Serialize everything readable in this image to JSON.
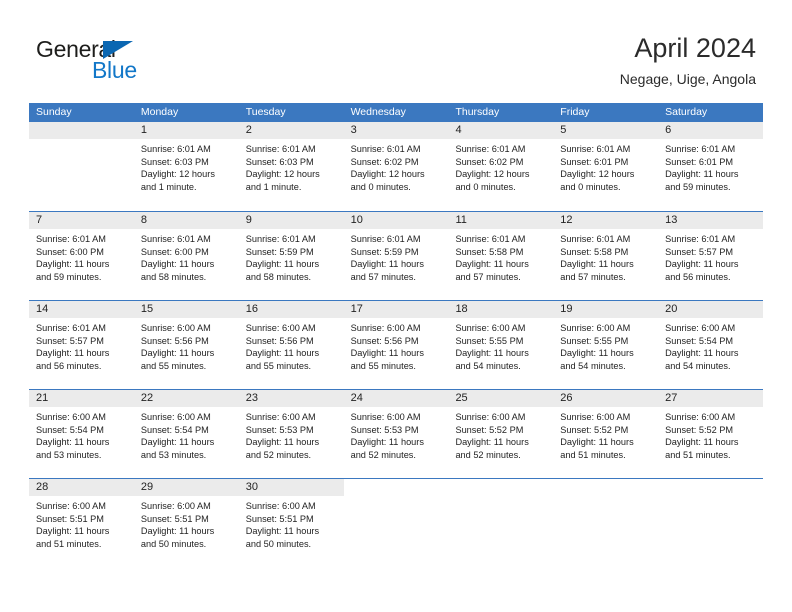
{
  "logo": {
    "word_one": "General",
    "word_two": "Blue",
    "triangle_icon": "triangle-icon",
    "brand_blue": "#1277c8",
    "brand_dark": "#1d1d1b"
  },
  "header": {
    "title": "April 2024",
    "subtitle": "Negage, Uige, Angola"
  },
  "theme": {
    "header_blue": "#3b78c0",
    "band_gray": "#ebebeb",
    "text": "#232323"
  },
  "weekday_headers": [
    "Sunday",
    "Monday",
    "Tuesday",
    "Wednesday",
    "Thursday",
    "Friday",
    "Saturday"
  ],
  "weeks": [
    [
      {
        "day": "",
        "lines": []
      },
      {
        "day": "1",
        "lines": [
          "Sunrise: 6:01 AM",
          "Sunset: 6:03 PM",
          "Daylight: 12 hours",
          "and 1 minute."
        ]
      },
      {
        "day": "2",
        "lines": [
          "Sunrise: 6:01 AM",
          "Sunset: 6:03 PM",
          "Daylight: 12 hours",
          "and 1 minute."
        ]
      },
      {
        "day": "3",
        "lines": [
          "Sunrise: 6:01 AM",
          "Sunset: 6:02 PM",
          "Daylight: 12 hours",
          "and 0 minutes."
        ]
      },
      {
        "day": "4",
        "lines": [
          "Sunrise: 6:01 AM",
          "Sunset: 6:02 PM",
          "Daylight: 12 hours",
          "and 0 minutes."
        ]
      },
      {
        "day": "5",
        "lines": [
          "Sunrise: 6:01 AM",
          "Sunset: 6:01 PM",
          "Daylight: 12 hours",
          "and 0 minutes."
        ]
      },
      {
        "day": "6",
        "lines": [
          "Sunrise: 6:01 AM",
          "Sunset: 6:01 PM",
          "Daylight: 11 hours",
          "and 59 minutes."
        ]
      }
    ],
    [
      {
        "day": "7",
        "lines": [
          "Sunrise: 6:01 AM",
          "Sunset: 6:00 PM",
          "Daylight: 11 hours",
          "and 59 minutes."
        ]
      },
      {
        "day": "8",
        "lines": [
          "Sunrise: 6:01 AM",
          "Sunset: 6:00 PM",
          "Daylight: 11 hours",
          "and 58 minutes."
        ]
      },
      {
        "day": "9",
        "lines": [
          "Sunrise: 6:01 AM",
          "Sunset: 5:59 PM",
          "Daylight: 11 hours",
          "and 58 minutes."
        ]
      },
      {
        "day": "10",
        "lines": [
          "Sunrise: 6:01 AM",
          "Sunset: 5:59 PM",
          "Daylight: 11 hours",
          "and 57 minutes."
        ]
      },
      {
        "day": "11",
        "lines": [
          "Sunrise: 6:01 AM",
          "Sunset: 5:58 PM",
          "Daylight: 11 hours",
          "and 57 minutes."
        ]
      },
      {
        "day": "12",
        "lines": [
          "Sunrise: 6:01 AM",
          "Sunset: 5:58 PM",
          "Daylight: 11 hours",
          "and 57 minutes."
        ]
      },
      {
        "day": "13",
        "lines": [
          "Sunrise: 6:01 AM",
          "Sunset: 5:57 PM",
          "Daylight: 11 hours",
          "and 56 minutes."
        ]
      }
    ],
    [
      {
        "day": "14",
        "lines": [
          "Sunrise: 6:01 AM",
          "Sunset: 5:57 PM",
          "Daylight: 11 hours",
          "and 56 minutes."
        ]
      },
      {
        "day": "15",
        "lines": [
          "Sunrise: 6:00 AM",
          "Sunset: 5:56 PM",
          "Daylight: 11 hours",
          "and 55 minutes."
        ]
      },
      {
        "day": "16",
        "lines": [
          "Sunrise: 6:00 AM",
          "Sunset: 5:56 PM",
          "Daylight: 11 hours",
          "and 55 minutes."
        ]
      },
      {
        "day": "17",
        "lines": [
          "Sunrise: 6:00 AM",
          "Sunset: 5:56 PM",
          "Daylight: 11 hours",
          "and 55 minutes."
        ]
      },
      {
        "day": "18",
        "lines": [
          "Sunrise: 6:00 AM",
          "Sunset: 5:55 PM",
          "Daylight: 11 hours",
          "and 54 minutes."
        ]
      },
      {
        "day": "19",
        "lines": [
          "Sunrise: 6:00 AM",
          "Sunset: 5:55 PM",
          "Daylight: 11 hours",
          "and 54 minutes."
        ]
      },
      {
        "day": "20",
        "lines": [
          "Sunrise: 6:00 AM",
          "Sunset: 5:54 PM",
          "Daylight: 11 hours",
          "and 54 minutes."
        ]
      }
    ],
    [
      {
        "day": "21",
        "lines": [
          "Sunrise: 6:00 AM",
          "Sunset: 5:54 PM",
          "Daylight: 11 hours",
          "and 53 minutes."
        ]
      },
      {
        "day": "22",
        "lines": [
          "Sunrise: 6:00 AM",
          "Sunset: 5:54 PM",
          "Daylight: 11 hours",
          "and 53 minutes."
        ]
      },
      {
        "day": "23",
        "lines": [
          "Sunrise: 6:00 AM",
          "Sunset: 5:53 PM",
          "Daylight: 11 hours",
          "and 52 minutes."
        ]
      },
      {
        "day": "24",
        "lines": [
          "Sunrise: 6:00 AM",
          "Sunset: 5:53 PM",
          "Daylight: 11 hours",
          "and 52 minutes."
        ]
      },
      {
        "day": "25",
        "lines": [
          "Sunrise: 6:00 AM",
          "Sunset: 5:52 PM",
          "Daylight: 11 hours",
          "and 52 minutes."
        ]
      },
      {
        "day": "26",
        "lines": [
          "Sunrise: 6:00 AM",
          "Sunset: 5:52 PM",
          "Daylight: 11 hours",
          "and 51 minutes."
        ]
      },
      {
        "day": "27",
        "lines": [
          "Sunrise: 6:00 AM",
          "Sunset: 5:52 PM",
          "Daylight: 11 hours",
          "and 51 minutes."
        ]
      }
    ],
    [
      {
        "day": "28",
        "lines": [
          "Sunrise: 6:00 AM",
          "Sunset: 5:51 PM",
          "Daylight: 11 hours",
          "and 51 minutes."
        ]
      },
      {
        "day": "29",
        "lines": [
          "Sunrise: 6:00 AM",
          "Sunset: 5:51 PM",
          "Daylight: 11 hours",
          "and 50 minutes."
        ]
      },
      {
        "day": "30",
        "lines": [
          "Sunrise: 6:00 AM",
          "Sunset: 5:51 PM",
          "Daylight: 11 hours",
          "and 50 minutes."
        ]
      },
      {
        "day": "",
        "lines": []
      },
      {
        "day": "",
        "lines": []
      },
      {
        "day": "",
        "lines": []
      },
      {
        "day": "",
        "lines": []
      }
    ]
  ]
}
